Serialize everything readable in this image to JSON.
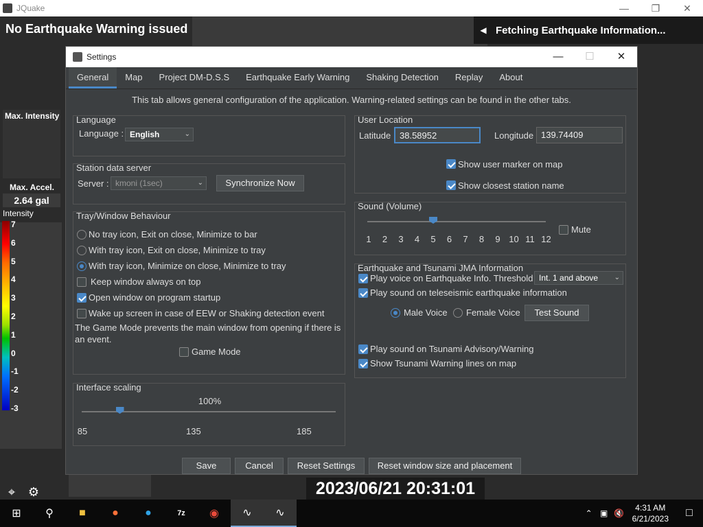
{
  "app": {
    "title": "JQuake",
    "warning": "No Earthquake Warning issued",
    "fetching": "Fetching Earthquake Information...",
    "max_intensity_label": "Max. Intensity",
    "max_accel_label": "Max. Accel.",
    "max_accel_value": "2.64 gal",
    "intensity_label": "Intensity",
    "scale_ticks": [
      "7",
      "6",
      "5",
      "4",
      "3",
      "2",
      "1",
      "0",
      "-1",
      "-2",
      "-3"
    ],
    "clock": "2023/06/21 20:31:01"
  },
  "dialog": {
    "title": "Settings",
    "tabs": [
      "General",
      "Map",
      "Project DM-D.S.S",
      "Earthquake Early Warning",
      "Shaking Detection",
      "Replay",
      "About"
    ],
    "active_tab": "General",
    "description": "This tab allows general configuration of the application. Warning-related settings can be found in the other tabs.",
    "language": {
      "group": "Language",
      "label": "Language :",
      "value": "English"
    },
    "station": {
      "group": "Station data server",
      "label": "Server :",
      "value": "kmoni (1sec)",
      "sync_button": "Synchronize Now"
    },
    "tray": {
      "group": "Tray/Window Behaviour",
      "options": [
        {
          "label": "No tray icon, Exit on close, Minimize to bar",
          "selected": false
        },
        {
          "label": "With tray icon, Exit on close, Minimize to tray",
          "selected": false
        },
        {
          "label": "With tray icon, Minimize on close, Minimize to tray",
          "selected": true
        }
      ],
      "keep_on_top": {
        "label": "Keep window always on top",
        "checked": false
      },
      "open_on_startup": {
        "label": "Open window on program startup",
        "checked": true
      },
      "wake_up": {
        "label": "Wake up screen in case of EEW or Shaking detection event",
        "checked": false
      },
      "game_mode_desc": "The Game Mode prevents the main window from opening if there is an event.",
      "game_mode": {
        "label": "Game Mode",
        "checked": false
      }
    },
    "scaling": {
      "group": "Interface scaling",
      "value": "100%",
      "value_num": 100,
      "ticks": [
        "85",
        "135",
        "185"
      ]
    },
    "location": {
      "group": "User Location",
      "lat_label": "Latitude",
      "lat_value": "38.58952",
      "lon_label": "Longitude",
      "lon_value": "139.74409",
      "show_marker": {
        "label": "Show user marker on map",
        "checked": true
      },
      "show_station": {
        "label": "Show closest station name",
        "checked": true
      }
    },
    "sound": {
      "group": "Sound (Volume)",
      "ticks": [
        "1",
        "2",
        "3",
        "4",
        "5",
        "6",
        "7",
        "8",
        "9",
        "10",
        "11",
        "12"
      ],
      "volume": 5,
      "mute": {
        "label": "Mute",
        "checked": false
      }
    },
    "jma": {
      "group": "Earthquake and Tsunami JMA Information",
      "play_voice": {
        "label": "Play voice on Earthquake Info. Threshold :",
        "checked": true
      },
      "threshold": "Int. 1 and above",
      "play_tele": {
        "label": "Play sound on teleseismic earthquake information",
        "checked": true
      },
      "male_voice": {
        "label": "Male Voice",
        "selected": true
      },
      "female_voice": {
        "label": "Female Voice",
        "selected": false
      },
      "test_sound": "Test Sound",
      "play_tsunami": {
        "label": "Play sound on Tsunami Advisory/Warning",
        "checked": true
      },
      "show_tsunami": {
        "label": "Show Tsunami Warning lines on map",
        "checked": true
      }
    },
    "buttons": {
      "save": "Save",
      "cancel": "Cancel",
      "reset": "Reset Settings",
      "reset_window": "Reset window size and placement"
    }
  },
  "taskbar": {
    "time": "4:31 AM",
    "date": "6/21/2023",
    "apps": [
      "start-icon",
      "search-icon",
      "file-explorer-icon",
      "firefox-icon",
      "edge-icon",
      "7zip-icon",
      "chrome-icon",
      "jquake-icon",
      "jquake-settings-icon"
    ]
  }
}
